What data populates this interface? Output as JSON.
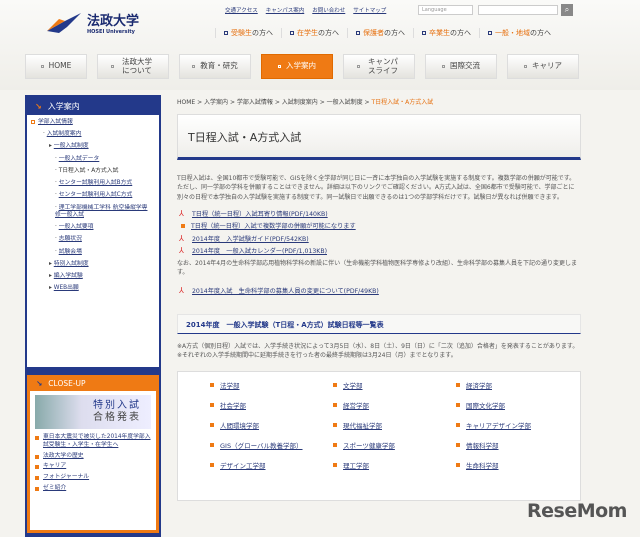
{
  "header": {
    "logo_ja": "法政大学",
    "logo_en": "HOSEI University",
    "util_links": [
      "交通アクセス",
      "キャンパス案内",
      "お問い合わせ",
      "サイトマップ"
    ],
    "language_placeholder": "Language",
    "audience": [
      {
        "hl": "受験生",
        "rest": "の方へ"
      },
      {
        "hl": "在学生",
        "rest": "の方へ"
      },
      {
        "hl": "保護者",
        "rest": "の方へ"
      },
      {
        "hl": "卒業生",
        "rest": "の方へ"
      },
      {
        "hl": "一般・地域",
        "rest": "の方へ"
      }
    ]
  },
  "nav": [
    "HOME",
    "法政大学について",
    "教育・研究",
    "入学案内",
    "キャンパスライフ",
    "国際交流",
    "キャリア"
  ],
  "sidebar": {
    "title": "入学案内",
    "items": [
      "学部入試情報",
      "入試制度案内",
      "一般入試制度",
      "一般入試データ",
      "T日程入試・A方式入試",
      "センター試験利用入試B方式",
      "センター試験利用入試C方式",
      "理工学部機械工学科 航空操縦学専修一般入試",
      "一般入試要項",
      "志願状況",
      "試験会場",
      "特別入試制度",
      "編入学試験",
      "WEB出願"
    ],
    "closeup_title": "CLOSE-UP",
    "banner": [
      "特別入試",
      "合格発表"
    ],
    "closeup_links": [
      "東日本大震災で被災した2014年度学部入試受験生・入学生・在学生へ",
      "法政大学の歴史",
      "キャリア",
      "フォトジャーナル",
      "ゼミ紹介"
    ]
  },
  "breadcrumb": [
    "HOME",
    "入学案内",
    "学部入試情報",
    "入試制度案内",
    "一般入試制度",
    "T日程入試・A方式入試"
  ],
  "main": {
    "title": "T日程入試・A方式入試",
    "intro": "T日程入試は、全国10都市で受験可能で、GISを除く全学部が同じ日に一斉に本学独自の入学試験を実施する制度です。複数学部の併願が可能です。ただし、同一学部の学科を併願することはできません。詳細は以下のリンクでご確認ください。A方式入試は、全国6都市で受験可能で、学部ごとに別々の日程で本学独自の入学試験を実施する制度です。同一試験日で出願できるのは1つの学部学科だけです。試験日が異なれば併願できます。",
    "links": [
      "T日程（統一日程）入試耳寄り情報(PDF/140KB)",
      "T日程（統一日程）入試で複数学部の併願が可能になります",
      "2014年度　入学試験ガイド(PDF/542KB)",
      "2014年度　一般入試カレンダー(PDF/1,013KB)"
    ],
    "note": "なお、2014年4月の生命科学部応用植物科学科の新設に伴い（生命機能学科植物医科学専修より改組）、生命科学部の募集人員を下記の通り変更します。",
    "note_link": "2014年度入試　生命科学部の募集人員の変更について(PDF/49KB)",
    "section_title": "2014年度　一般入学試験（T日程・A方式）試験日程等一覧表",
    "remarks": [
      "※A方式（個別日程）入試では、入学手続き状況によって3月5日（水）、8日（土）、9日（日）に「二次（追加）合格者」を発表することがあります。",
      "※それぞれの入学手続期間中に延期手続きを行った者の最終手続期限は3月24日（月）までとなります。"
    ],
    "faculties": [
      "法学部",
      "文学部",
      "経済学部",
      "社会学部",
      "経営学部",
      "国際文化学部",
      "人間環境学部",
      "現代福祉学部",
      "キャリアデザイン学部",
      "GIS（グローバル教養学部）",
      "スポーツ健康学部",
      "情報科学部",
      "デザイン工学部",
      "理工学部",
      "生命科学部"
    ]
  },
  "watermark": "ReseMom"
}
